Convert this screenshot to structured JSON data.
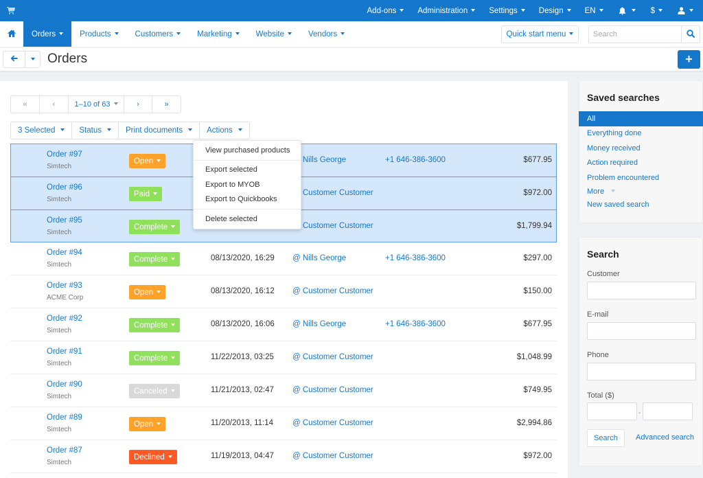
{
  "topbar": {
    "cart_icon": "shopping-cart-icon",
    "items": [
      {
        "label": "Add-ons"
      },
      {
        "label": "Administration"
      },
      {
        "label": "Settings"
      },
      {
        "label": "Design"
      },
      {
        "label": "EN"
      },
      {
        "icon": "bell-icon"
      },
      {
        "label": "$"
      },
      {
        "icon": "user-icon"
      }
    ]
  },
  "mainnav": {
    "home_icon": "home-icon",
    "items": [
      {
        "label": "Orders",
        "active": true
      },
      {
        "label": "Products"
      },
      {
        "label": "Customers"
      },
      {
        "label": "Marketing"
      },
      {
        "label": "Website"
      },
      {
        "label": "Vendors"
      }
    ],
    "quick_start": "Quick start menu",
    "search_placeholder": "Search"
  },
  "titlebar": {
    "title": "Orders",
    "add_label": "+"
  },
  "pager": {
    "first": "«",
    "prev": "‹",
    "range": "1–10 of 63",
    "next": "›",
    "last": "»"
  },
  "actionbar": {
    "selected": "3 Selected",
    "status": "Status",
    "print": "Print documents",
    "actions": "Actions"
  },
  "actions_menu": {
    "items": [
      "View purchased products",
      "Export selected",
      "Export to MYOB",
      "Export to Quickbooks",
      "Delete selected"
    ]
  },
  "status_colors": {
    "Open": "#ffa22a",
    "Paid": "#8fe05a",
    "Complete": "#8fe05a",
    "Canceled": "#d9d9d9",
    "Declined": "#ff5a24"
  },
  "orders": [
    {
      "id": "Order #97",
      "company": "Simtech",
      "status": "Open",
      "date": "",
      "customer": "@ Nills George",
      "phone": "+1 646-386-3600",
      "total": "$677.95",
      "selected": true
    },
    {
      "id": "Order #96",
      "company": "Simtech",
      "status": "Paid",
      "date": "",
      "customer": "@ Customer Customer",
      "phone": "",
      "total": "$972.00",
      "selected": true
    },
    {
      "id": "Order #95",
      "company": "Simtech",
      "status": "Complete",
      "date": "",
      "customer": "@ Customer Customer",
      "phone": "",
      "total": "$1,799.94",
      "selected": true
    },
    {
      "id": "Order #94",
      "company": "Simtech",
      "status": "Complete",
      "date": "08/13/2020, 16:29",
      "customer": "@ Nills George",
      "phone": "+1 646-386-3600",
      "total": "$297.00",
      "selected": false
    },
    {
      "id": "Order #93",
      "company": "ACME Corp",
      "status": "Open",
      "date": "08/13/2020, 16:12",
      "customer": "@ Customer Customer",
      "phone": "",
      "total": "$150.00",
      "selected": false
    },
    {
      "id": "Order #92",
      "company": "Simtech",
      "status": "Complete",
      "date": "08/13/2020, 16:06",
      "customer": "@ Nills George",
      "phone": "+1 646-386-3600",
      "total": "$677.95",
      "selected": false
    },
    {
      "id": "Order #91",
      "company": "Simtech",
      "status": "Complete",
      "date": "11/22/2013, 03:25",
      "customer": "@ Customer Customer",
      "phone": "",
      "total": "$1,048.99",
      "selected": false
    },
    {
      "id": "Order #90",
      "company": "Simtech",
      "status": "Canceled",
      "date": "11/21/2013, 02:47",
      "customer": "@ Customer Customer",
      "phone": "",
      "total": "$749.95",
      "selected": false
    },
    {
      "id": "Order #89",
      "company": "Simtech",
      "status": "Open",
      "date": "11/20/2013, 11:14",
      "customer": "@ Customer Customer",
      "phone": "",
      "total": "$2,994.86",
      "selected": false
    },
    {
      "id": "Order #87",
      "company": "Simtech",
      "status": "Declined",
      "date": "11/19/2013, 04:47",
      "customer": "@ Customer Customer",
      "phone": "",
      "total": "$972.00",
      "selected": false
    }
  ],
  "saved_searches": {
    "title": "Saved searches",
    "items": [
      {
        "label": "All",
        "active": true
      },
      {
        "label": "Everything done"
      },
      {
        "label": "Money received"
      },
      {
        "label": "Action required"
      },
      {
        "label": "Problem encountered"
      },
      {
        "label": "More"
      },
      {
        "label": "New saved search"
      }
    ]
  },
  "search_panel": {
    "title": "Search",
    "customer_label": "Customer",
    "email_label": "E-mail",
    "phone_label": "Phone",
    "total_label": "Total ($)",
    "range_sep": "-",
    "customer_value": "",
    "email_value": "",
    "phone_value": "",
    "total_from": "",
    "total_to": "",
    "search_button": "Search",
    "advanced_link": "Advanced search"
  }
}
